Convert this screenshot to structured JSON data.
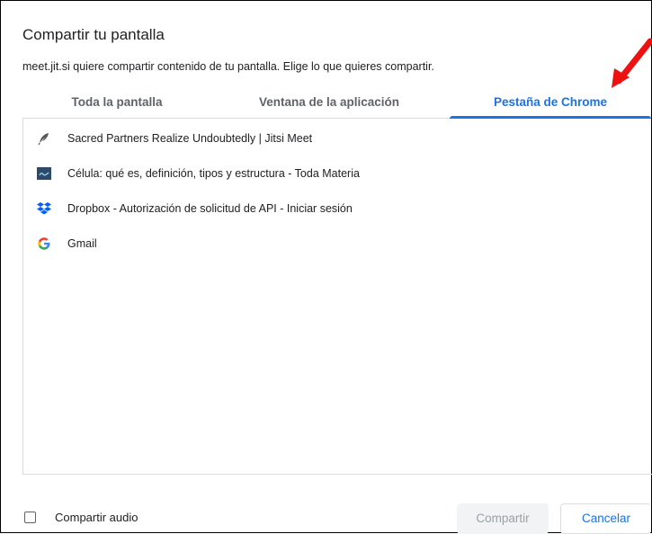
{
  "dialog": {
    "title": "Compartir tu pantalla",
    "subtitle": "meet.jit.si quiere compartir contenido de tu pantalla. Elige lo que quieres compartir."
  },
  "tabs": [
    {
      "label": "Toda la pantalla",
      "active": false
    },
    {
      "label": "Ventana de la aplicación",
      "active": false
    },
    {
      "label": "Pestaña de Chrome",
      "active": true
    }
  ],
  "items": [
    {
      "label": "Sacred Partners Realize Undoubtedly | Jitsi Meet",
      "icon": "jitsi-feather-icon"
    },
    {
      "label": "Célula: qué es, definición, tipos y estructura - Toda Materia",
      "icon": "toda-materia-icon"
    },
    {
      "label": "Dropbox - Autorización de solicitud de API - Iniciar sesión",
      "icon": "dropbox-icon"
    },
    {
      "label": "Gmail",
      "icon": "google-icon"
    }
  ],
  "footer": {
    "audio_label": "Compartir audio",
    "audio_checked": false,
    "share_label": "Compartir",
    "share_enabled": false,
    "cancel_label": "Cancelar"
  },
  "colors": {
    "accent": "#1a73e8",
    "annotation_arrow": "#ee1111"
  }
}
